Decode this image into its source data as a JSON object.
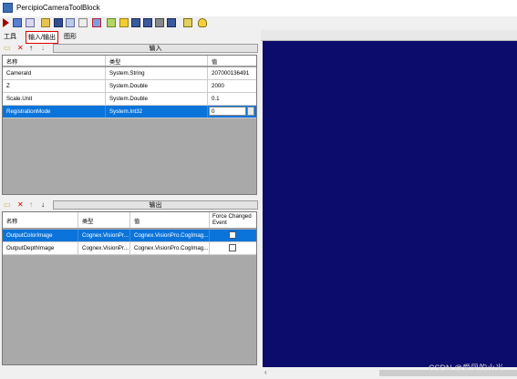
{
  "window": {
    "title": "PercipioCameraToolBlock"
  },
  "tabs": [
    {
      "label": "工具"
    },
    {
      "label": "输入/输出"
    },
    {
      "label": "图形"
    }
  ],
  "inputs_panel": {
    "header": "输入",
    "columns": [
      "名称",
      "类型",
      "值"
    ],
    "rows": [
      {
        "name": "CameraId",
        "type": "System.String",
        "value": "207000136491"
      },
      {
        "name": "Z",
        "type": "System.Double",
        "value": "2000"
      },
      {
        "name": "Scale.Unit",
        "type": "System.Double",
        "value": "0.1"
      },
      {
        "name": "RegistrationMode",
        "type": "System.Int32",
        "value": "0"
      }
    ]
  },
  "outputs_panel": {
    "header": "输出",
    "columns": [
      "名称",
      "类型",
      "值",
      "Force Changed Event"
    ],
    "rows": [
      {
        "name": "OutputColorImage",
        "type": "Cognex.VisionPr...",
        "value": "Cognex.VisionPro.CogImag..."
      },
      {
        "name": "OutputDepthImage",
        "type": "Cognex.VisionPr...",
        "value": "Cognex.VisionPro.CogImag..."
      }
    ]
  },
  "watermark": "CSDN @爱凤的小光",
  "colors": {
    "display_bg": "#0c0c6c",
    "selection": "#0a74da"
  }
}
